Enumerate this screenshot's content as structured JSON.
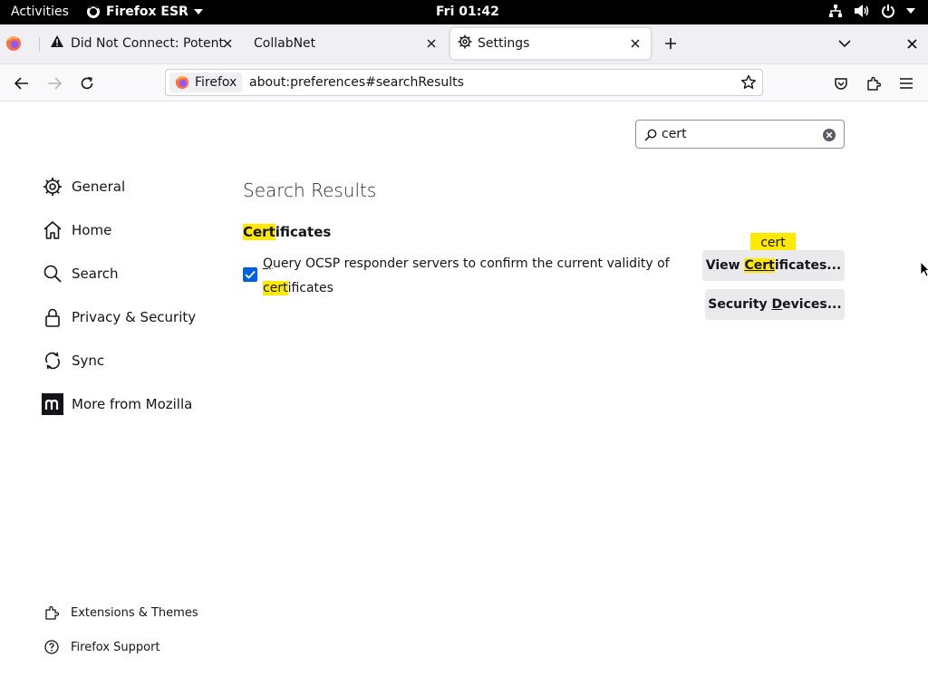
{
  "system_bar": {
    "activities": "Activities",
    "app_name": "Firefox ESR",
    "clock": "Fri 01:42"
  },
  "tabs": [
    {
      "title": "Did Not Connect: Potenti",
      "icon": "warning-icon"
    },
    {
      "title": "CollabNet",
      "icon": "none"
    },
    {
      "title": "Settings",
      "icon": "gear-icon",
      "selected": true
    }
  ],
  "navbar": {
    "identity_label": "Firefox",
    "url": "about:preferences#searchResults"
  },
  "search": {
    "value": "cert"
  },
  "sidebar": {
    "items": [
      {
        "label": "General",
        "icon": "gear-icon"
      },
      {
        "label": "Home",
        "icon": "home-icon"
      },
      {
        "label": "Search",
        "icon": "search-icon"
      },
      {
        "label": "Privacy & Security",
        "icon": "lock-icon"
      },
      {
        "label": "Sync",
        "icon": "sync-icon"
      },
      {
        "label": "More from Mozilla",
        "icon": "mozilla-icon"
      }
    ],
    "footer": [
      {
        "label": "Extensions & Themes",
        "icon": "puzzle-icon"
      },
      {
        "label": "Firefox Support",
        "icon": "help-icon"
      }
    ]
  },
  "main": {
    "title": "Search Results",
    "section": {
      "highlight": "Cert",
      "rest": "ificates"
    },
    "ocsp": {
      "checked": true,
      "access_key": "Q",
      "text_part1": "uery OCSP responder servers to confirm the current validity of ",
      "highlight": "cert",
      "text_part2": "ificates"
    },
    "view_certificates": {
      "prefix": "View ",
      "highlight": "Cert",
      "suffix": "ificates..."
    },
    "security_devices": {
      "prefix": "Security ",
      "access_key": "D",
      "suffix": "evices..."
    },
    "tooltip": "cert"
  },
  "colors": {
    "highlight": "#ffe900",
    "accent": "#0061e0",
    "top_bar": "#000000"
  }
}
